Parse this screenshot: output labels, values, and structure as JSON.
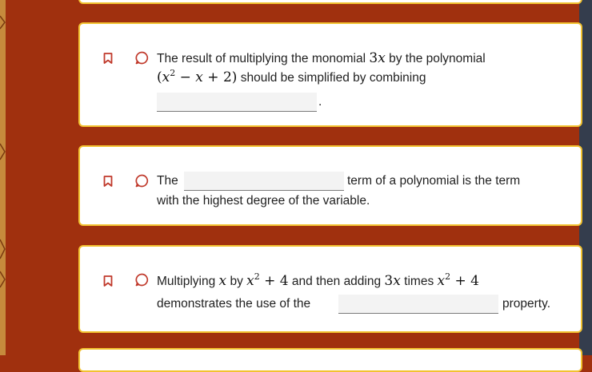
{
  "colors": {
    "background": "#a0300e",
    "card_border": "#f2c230",
    "card_background": "#ffffff",
    "right_rail": "#343d4d",
    "icon": "#c0392b",
    "blank_fill": "#f3f3f3"
  },
  "questions": [
    {
      "line1": {
        "text_before": "The result of multiplying the monomial",
        "math_a": "3x",
        "text_mid": "by the polynomial"
      },
      "line2": {
        "math_expr": "(x² − x + 2)",
        "text_after": "should be simplified by combining"
      },
      "blank_value": "",
      "trailing_punct": "."
    },
    {
      "line1": {
        "text_before": "The",
        "blank_value": "",
        "text_after": "term of a polynomial is the term"
      },
      "line2": {
        "text": "with the highest degree of the variable."
      }
    },
    {
      "line1": {
        "text_a": "Multiplying",
        "math_a": "x",
        "text_b": "by",
        "math_b": "x² + 4",
        "text_c": "and then adding",
        "math_c": "3x",
        "text_d": "times",
        "math_d": "x² + 4"
      },
      "line2": {
        "text_before": "demonstrates the use of the",
        "blank_value": "",
        "text_after": "property."
      }
    }
  ],
  "icons": [
    "bookmark-icon",
    "comment-icon"
  ]
}
